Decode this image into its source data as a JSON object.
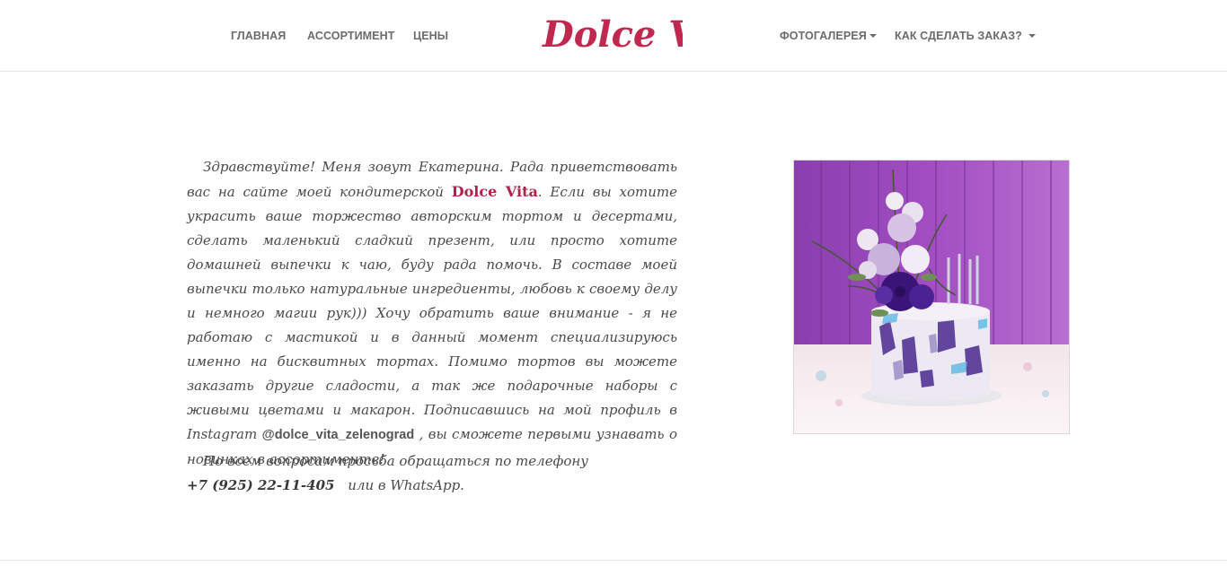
{
  "nav": {
    "left": [
      "Главная",
      "Ассортимент",
      "Цены"
    ],
    "right": [
      {
        "label": "Фотогалерея",
        "dropdown": true
      },
      {
        "label": "Как сделать заказ?",
        "dropdown": true
      }
    ]
  },
  "logo": {
    "text": "Dolce Vita",
    "color": "#c0294f"
  },
  "intro": {
    "part1": "Здравствуйте! Меня зовут Екатерина. Рада приветствовать вас на сайте моей кондитерской",
    "brand": "Dolce Vita",
    "part2": ". Если вы хотите украсить ваше торжество авторским тортом и десертами, сделать маленький сладкий презент, или просто хотите домашней выпечки к чаю, буду рада помочь. В составе моей выпечки только натуральные ингредиенты, любовь к своему делу и немного магии рук))) Хочу обратить ваше внимание - я не работаю с мастикой и в данный момент специализируюсь именно на бисквитных тортах. Помимо тортов вы можете заказать другие сладости, а так же подарочные наборы с живыми цветами и макарон. Подписавшись на мой профиль в Instagram",
    "instagram": "@dolce_vita_zelenograd",
    "part3": ", вы сможете первыми узнавать о новинках в ассортименте!"
  },
  "contact": {
    "line1": "По всем вопросам просьба обращаться по телефону",
    "phone": "+7 (925) 22-11-405",
    "line2_rest": "или в WhatsApp."
  },
  "colors": {
    "accent": "#c0294f",
    "nav_text": "#6b6b6b",
    "body_text": "#4a4a4a"
  }
}
